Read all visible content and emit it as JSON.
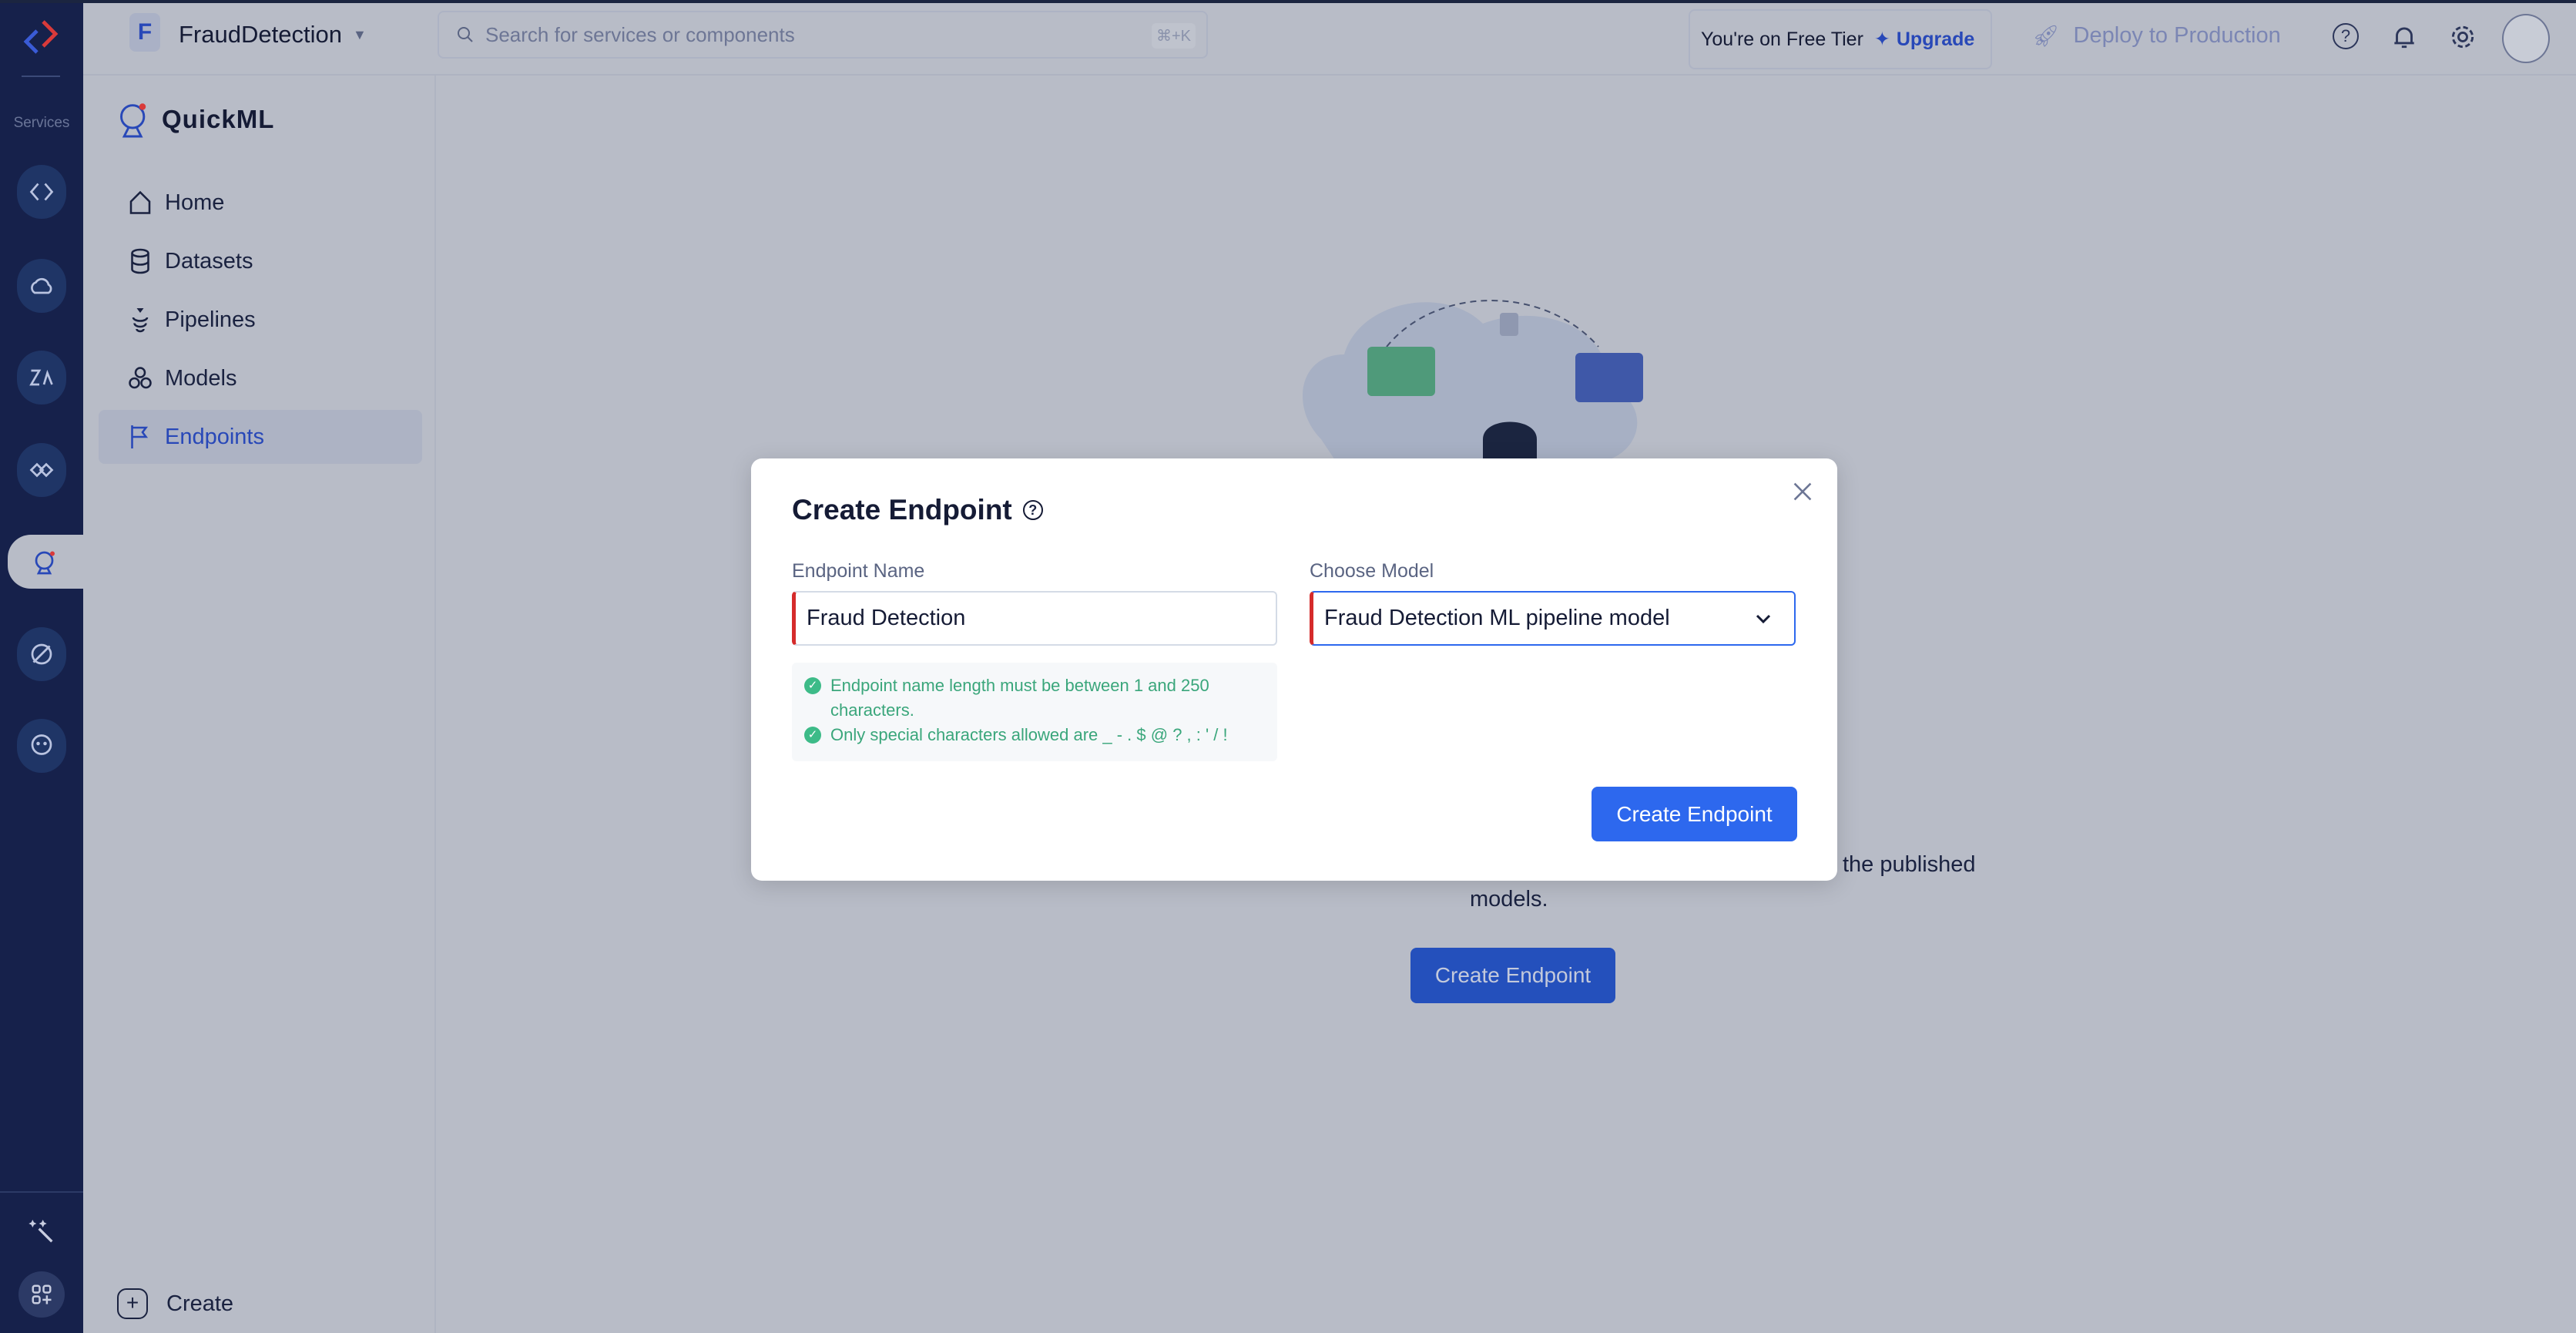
{
  "topbar": {
    "project_initial": "F",
    "project_name": "FraudDetection",
    "search_placeholder": "Search for services or components",
    "search_shortcut": "⌘+K",
    "tier_text": "You're on Free Tier",
    "upgrade_label": "Upgrade",
    "deploy_label": "Deploy to Production"
  },
  "rail": {
    "services_label": "Services"
  },
  "sidebar": {
    "app_name": "QuickML",
    "items": [
      {
        "label": "Home"
      },
      {
        "label": "Datasets"
      },
      {
        "label": "Pipelines"
      },
      {
        "label": "Models"
      },
      {
        "label": "Endpoints",
        "active": true
      }
    ],
    "create_label": "Create"
  },
  "background": {
    "description_end": "the published",
    "description_line2": "models.",
    "create_button": "Create Endpoint"
  },
  "modal": {
    "title": "Create Endpoint",
    "endpoint_name_label": "Endpoint Name",
    "endpoint_name_value": "Fraud Detection",
    "model_label": "Choose Model",
    "model_value": "Fraud Detection ML pipeline model",
    "hints": [
      "Endpoint name length must be between 1 and 250 characters.",
      "Only special characters allowed are _ - . $ @ ? , : ' / !"
    ],
    "submit_label": "Create Endpoint"
  },
  "colors": {
    "primary": "#2d68ee",
    "rail": "#16214b",
    "error": "#d52b2b",
    "success": "#3aa67b"
  }
}
